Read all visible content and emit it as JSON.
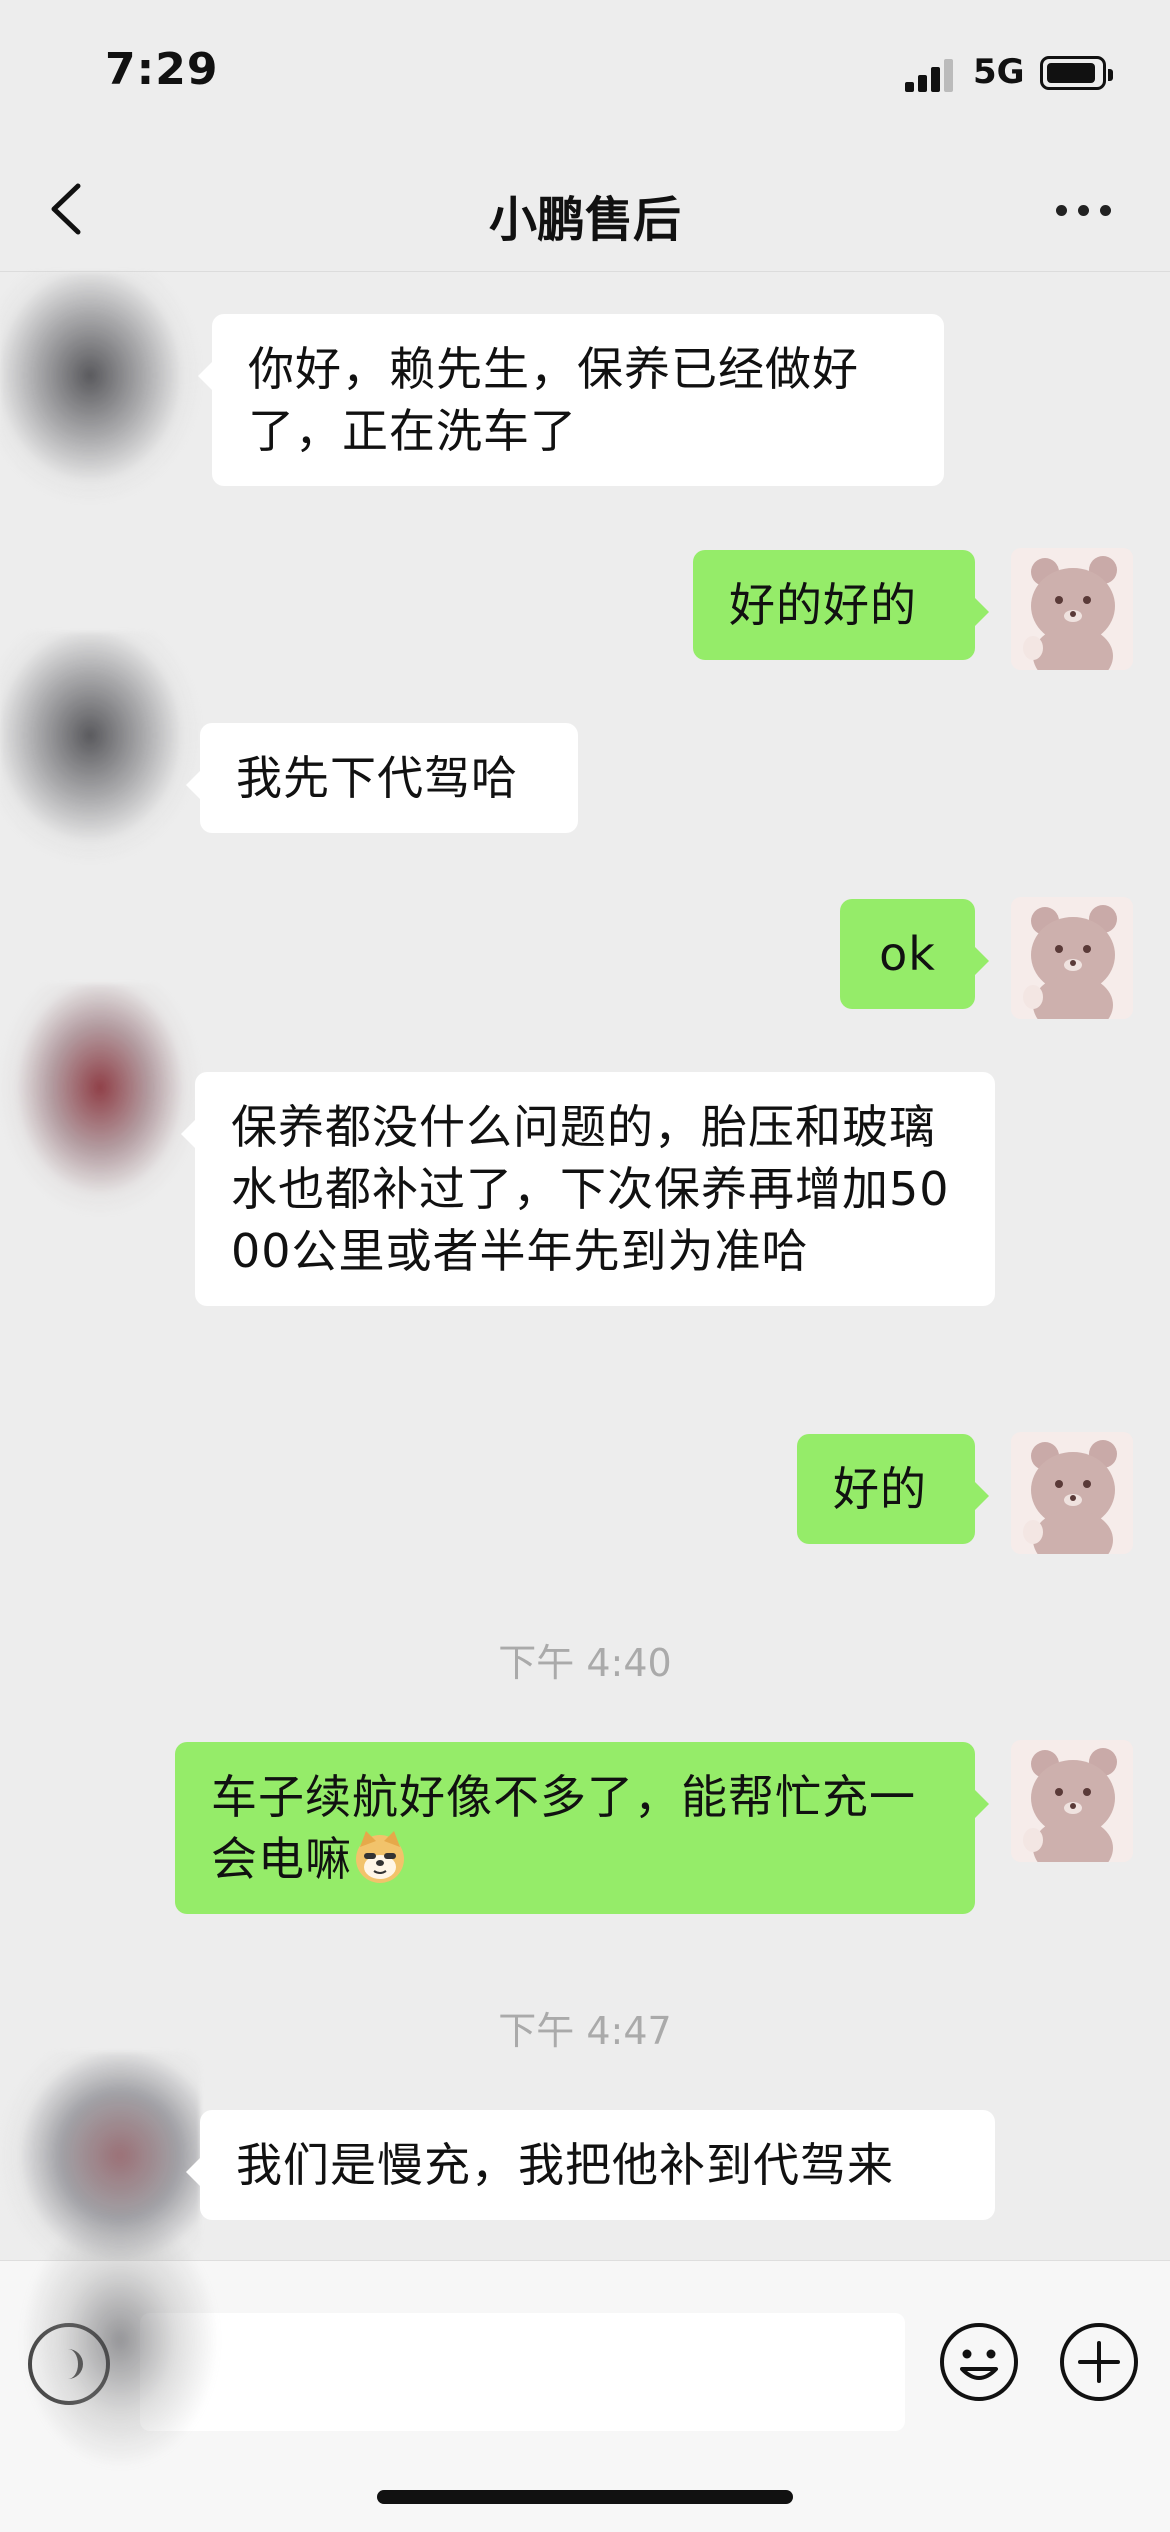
{
  "status_bar": {
    "time": "7:29",
    "network": "5G"
  },
  "nav": {
    "title": "小鹏售后"
  },
  "messages": [
    {
      "side": "left",
      "text": "你好，赖先生，保养已经做好了，正在洗车了"
    },
    {
      "side": "right",
      "text": "好的好的"
    },
    {
      "side": "left",
      "text": "我先下代驾哈"
    },
    {
      "side": "right",
      "text": "ok"
    },
    {
      "side": "left",
      "text": "保养都没什么问题的，胎压和玻璃水也都补过了，下次保养再增加5000公里或者半年先到为准哈"
    },
    {
      "side": "right",
      "text": "好的"
    },
    {
      "type": "timestamp",
      "text": "下午 4:40"
    },
    {
      "side": "right",
      "text": "车子续航好像不多了，能帮忙充一会电嘛",
      "emoji": "doge"
    },
    {
      "type": "timestamp",
      "text": "下午 4:47"
    },
    {
      "side": "left",
      "text": "我们是慢充，我把他补到代驾来"
    }
  ],
  "colors": {
    "bubble_right": "#95ec69",
    "bubble_left": "#ffffff",
    "background": "#ededed"
  },
  "icons": [
    "back-arrow-icon",
    "more-dots-icon",
    "voice-icon",
    "emoji-icon",
    "plus-icon",
    "bear-avatar"
  ]
}
